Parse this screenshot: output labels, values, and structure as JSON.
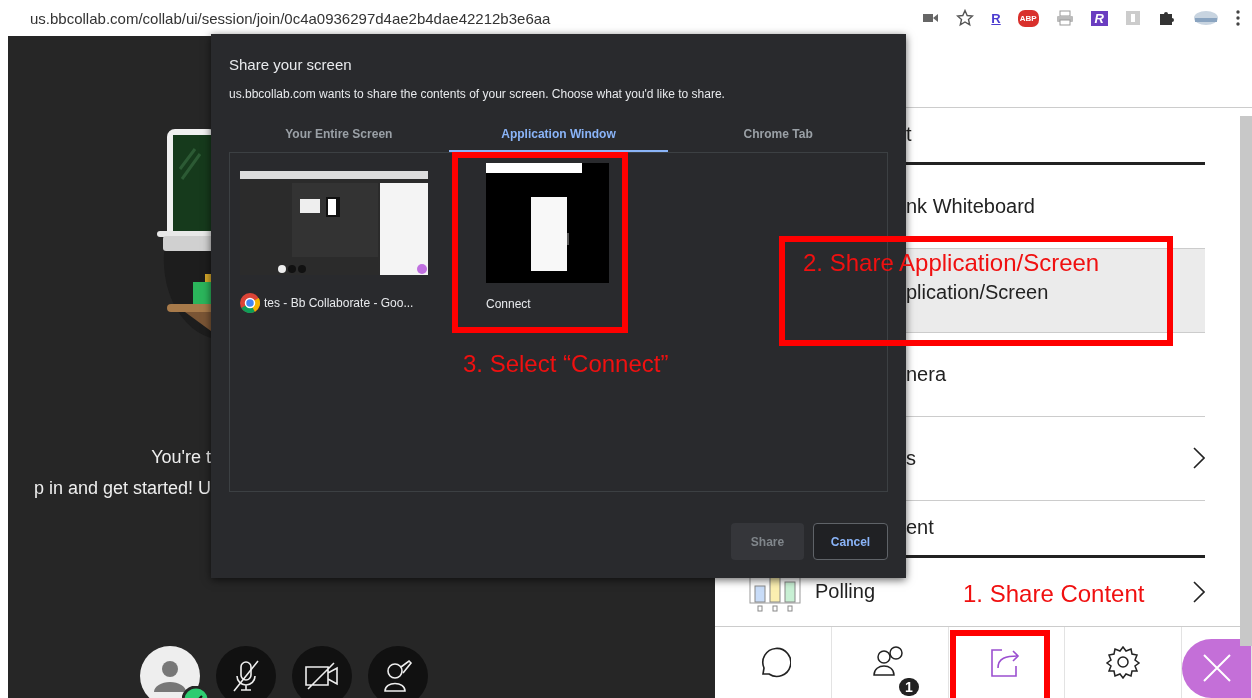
{
  "address_bar": {
    "url": "us.bbcollab.com/collab/ui/session/join/0c4a0936297d4ae2b4dae42212b3e6aa",
    "extension_badges": [
      "R",
      "ABP",
      "R"
    ]
  },
  "stage": {
    "message_lines": [
      "You're t",
      "p in and get started! U"
    ],
    "status_ok": true
  },
  "dialog": {
    "title": "Share your screen",
    "description": "us.bbcollab.com wants to share the contents of your screen. Choose what you'd like to share.",
    "tabs": [
      {
        "label": "Your Entire Screen",
        "selected": false
      },
      {
        "label": "Application Window",
        "selected": true
      },
      {
        "label": "Chrome Tab",
        "selected": false
      }
    ],
    "sources": [
      {
        "label": "tes - Bb Collaborate - Goo...",
        "kind": "browser"
      },
      {
        "label": "Connect",
        "kind": "app"
      }
    ],
    "buttons": [
      {
        "label": "Share",
        "disabled": true
      },
      {
        "label": "Cancel",
        "disabled": false
      }
    ]
  },
  "panel": {
    "rows": [
      {
        "kind": "header",
        "label": "t"
      },
      {
        "kind": "item",
        "label": "nk Whiteboard",
        "selected": false,
        "submenu": false
      },
      {
        "kind": "item",
        "label": "plication/Screen",
        "selected": true,
        "submenu": false
      },
      {
        "kind": "item",
        "label": "nera",
        "selected": false,
        "submenu": false
      },
      {
        "kind": "item",
        "label": "s",
        "selected": false,
        "submenu": true
      },
      {
        "kind": "header",
        "label": "ent"
      },
      {
        "kind": "poll",
        "label": "Polling",
        "selected": false,
        "submenu": true
      }
    ]
  },
  "toolbar": {
    "items": [
      {
        "kind": "chat",
        "selected": false
      },
      {
        "kind": "attendees",
        "selected": false,
        "badge": "1"
      },
      {
        "kind": "share",
        "selected": true
      },
      {
        "kind": "settings",
        "selected": false
      },
      {
        "kind": "close",
        "selected": false
      }
    ]
  },
  "annotations": [
    {
      "text": "1. Share Content"
    },
    {
      "text": "2. Share Application/Screen"
    },
    {
      "text": "3. Select “Connect”"
    }
  ]
}
